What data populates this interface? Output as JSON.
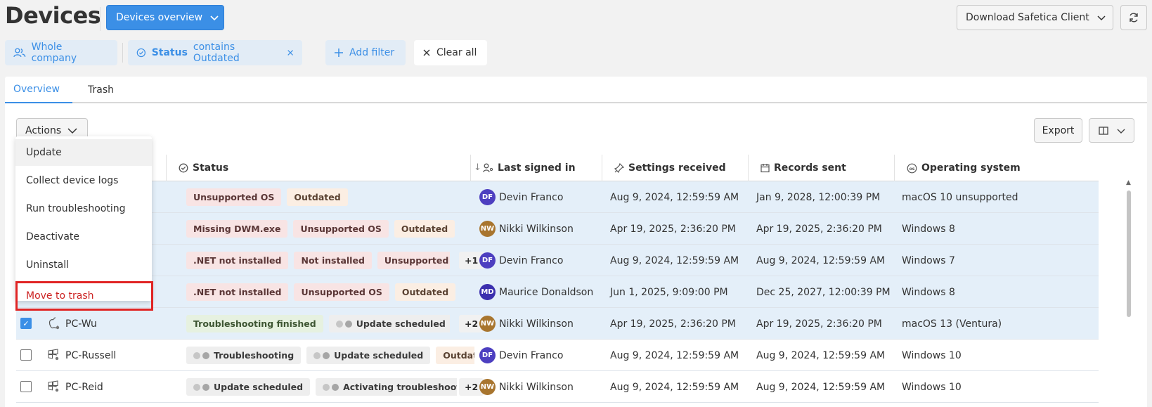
{
  "header": {
    "title": "Devices",
    "view_select": "Devices overview",
    "download_client": "Download Safetica Client"
  },
  "filters": {
    "scope": "Whole company",
    "status_field": "Status",
    "status_condition": "contains Outdated",
    "add_filter": "Add filter",
    "clear_all": "Clear all"
  },
  "tabs": {
    "overview": "Overview",
    "trash": "Trash"
  },
  "toolbar": {
    "actions": "Actions",
    "export": "Export"
  },
  "menu": {
    "items": [
      "Update",
      "Collect device logs",
      "Run troubleshooting",
      "Deactivate",
      "Uninstall",
      "Move to trash"
    ]
  },
  "table": {
    "headers": {
      "status": "Status",
      "last_signed_in": "Last signed in",
      "settings_received": "Settings received",
      "records_sent": "Records sent",
      "operating_system": "Operating system"
    },
    "rows": [
      {
        "device": "",
        "status_badges": [
          "Unsupported OS",
          "Outdated"
        ],
        "more": "",
        "user_initials": "DF",
        "user": "Devin Franco",
        "settings_received": "Aug 9, 2024, 12:59:59 AM",
        "records_sent": "Jan 9, 2028, 12:00:39 PM",
        "os": "macOS 10 unsupported"
      },
      {
        "device": "",
        "status_badges": [
          "Missing DWM.exe",
          "Unsupported OS",
          "Outdated"
        ],
        "more": "",
        "user_initials": "NW",
        "user": "Nikki Wilkinson",
        "settings_received": "Apr 19, 2025, 2:36:20 PM",
        "records_sent": "Apr 19, 2025, 2:36:20 PM",
        "os": "Windows 8"
      },
      {
        "device": "",
        "status_badges": [
          ".NET not installed",
          "Not installed",
          "Unsupported OS"
        ],
        "more": "+1",
        "user_initials": "DF",
        "user": "Devin Franco",
        "settings_received": "Aug 9, 2024, 12:59:59 AM",
        "records_sent": "Aug 9, 2024, 12:59:59 AM",
        "os": "Windows 7"
      },
      {
        "device": "",
        "status_badges": [
          ".NET not installed",
          "Unsupported OS",
          "Outdated"
        ],
        "more": "",
        "user_initials": "MD",
        "user": "Maurice Donaldson",
        "settings_received": "Jun 1, 2025, 9:09:00 PM",
        "records_sent": "Dec 25, 2027, 12:00:39 PM",
        "os": "Windows 8"
      },
      {
        "device": "PC-Wu",
        "status_badges": [
          "Troubleshooting finished",
          "Update scheduled"
        ],
        "more": "+2",
        "user_initials": "NW",
        "user": "Nikki Wilkinson",
        "settings_received": "Apr 19, 2025, 2:36:20 PM",
        "records_sent": "Apr 19, 2025, 2:36:20 PM",
        "os": "macOS 13 (Ventura)"
      },
      {
        "device": "PC-Russell",
        "status_badges": [
          "Troubleshooting",
          "Update scheduled",
          "Outdated"
        ],
        "more": "",
        "user_initials": "DF",
        "user": "Devin Franco",
        "settings_received": "Aug 9, 2024, 12:59:59 AM",
        "records_sent": "Aug 9, 2024, 12:59:59 AM",
        "os": "Windows 10"
      },
      {
        "device": "PC-Reid",
        "status_badges": [
          "Update scheduled",
          "Activating troubleshooting"
        ],
        "more": "+2",
        "user_initials": "NW",
        "user": "Nikki Wilkinson",
        "settings_received": "Aug 9, 2024, 12:59:59 AM",
        "records_sent": "Aug 9, 2024, 12:59:59 AM",
        "os": "Windows 10"
      }
    ]
  },
  "colors": {
    "accent": "#3b8fe6",
    "selected_row": "#e4eff9",
    "danger": "#e02424"
  }
}
